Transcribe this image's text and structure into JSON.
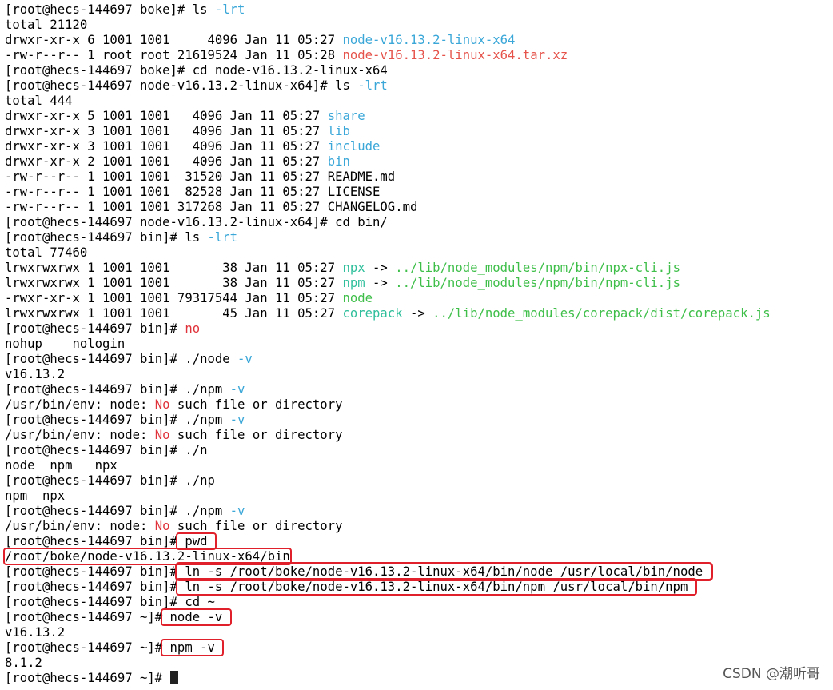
{
  "lines": [
    {
      "parts": [
        {
          "t": "[root@hecs-144697 boke]# ls "
        },
        {
          "t": "-lrt",
          "c": "flag"
        }
      ]
    },
    {
      "parts": [
        {
          "t": "total 21120"
        }
      ]
    },
    {
      "parts": [
        {
          "t": "drwxr-xr-x 6 1001 1001     4096 Jan 11 05:27 "
        },
        {
          "t": "node-v16.13.2-linux-x64",
          "c": "dir"
        }
      ]
    },
    {
      "parts": [
        {
          "t": "-rw-r--r-- 1 root root 21619524 Jan 11 05:28 "
        },
        {
          "t": "node-v16.13.2-linux-x64.tar.xz",
          "c": "arc"
        }
      ]
    },
    {
      "parts": [
        {
          "t": "[root@hecs-144697 boke]# cd node-v16.13.2-linux-x64"
        }
      ]
    },
    {
      "parts": [
        {
          "t": "[root@hecs-144697 node-v16.13.2-linux-x64]# ls "
        },
        {
          "t": "-lrt",
          "c": "flag"
        }
      ]
    },
    {
      "parts": [
        {
          "t": "total 444"
        }
      ]
    },
    {
      "parts": [
        {
          "t": "drwxr-xr-x 5 1001 1001   4096 Jan 11 05:27 "
        },
        {
          "t": "share",
          "c": "dir"
        }
      ]
    },
    {
      "parts": [
        {
          "t": "drwxr-xr-x 3 1001 1001   4096 Jan 11 05:27 "
        },
        {
          "t": "lib",
          "c": "dir"
        }
      ]
    },
    {
      "parts": [
        {
          "t": "drwxr-xr-x 3 1001 1001   4096 Jan 11 05:27 "
        },
        {
          "t": "include",
          "c": "dir"
        }
      ]
    },
    {
      "parts": [
        {
          "t": "drwxr-xr-x 2 1001 1001   4096 Jan 11 05:27 "
        },
        {
          "t": "bin",
          "c": "dir"
        }
      ]
    },
    {
      "parts": [
        {
          "t": "-rw-r--r-- 1 1001 1001  31520 Jan 11 05:27 README.md"
        }
      ]
    },
    {
      "parts": [
        {
          "t": "-rw-r--r-- 1 1001 1001  82528 Jan 11 05:27 LICENSE"
        }
      ]
    },
    {
      "parts": [
        {
          "t": "-rw-r--r-- 1 1001 1001 317268 Jan 11 05:27 CHANGELOG.md"
        }
      ]
    },
    {
      "parts": [
        {
          "t": "[root@hecs-144697 node-v16.13.2-linux-x64]# cd bin/"
        }
      ]
    },
    {
      "parts": [
        {
          "t": "[root@hecs-144697 bin]# ls "
        },
        {
          "t": "-lrt",
          "c": "flag"
        }
      ]
    },
    {
      "parts": [
        {
          "t": "total 77460"
        }
      ]
    },
    {
      "parts": [
        {
          "t": "lrwxrwxrwx 1 1001 1001       38 Jan 11 05:27 "
        },
        {
          "t": "npx",
          "c": "lnk"
        },
        {
          "t": " -> "
        },
        {
          "t": "../lib/node_modules/npm/bin/npx-cli.js",
          "c": "exe"
        }
      ]
    },
    {
      "parts": [
        {
          "t": "lrwxrwxrwx 1 1001 1001       38 Jan 11 05:27 "
        },
        {
          "t": "npm",
          "c": "lnk"
        },
        {
          "t": " -> "
        },
        {
          "t": "../lib/node_modules/npm/bin/npm-cli.js",
          "c": "exe"
        }
      ]
    },
    {
      "parts": [
        {
          "t": "-rwxr-xr-x 1 1001 1001 79317544 Jan 11 05:27 "
        },
        {
          "t": "node",
          "c": "exe"
        }
      ]
    },
    {
      "parts": [
        {
          "t": "lrwxrwxrwx 1 1001 1001       45 Jan 11 05:27 "
        },
        {
          "t": "corepack",
          "c": "lnk"
        },
        {
          "t": " -> "
        },
        {
          "t": "../lib/node_modules/corepack/dist/corepack.js",
          "c": "exe"
        }
      ]
    },
    {
      "parts": [
        {
          "t": "[root@hecs-144697 bin]# "
        },
        {
          "t": "no",
          "c": "red"
        }
      ]
    },
    {
      "parts": [
        {
          "t": "nohup    nologin"
        }
      ]
    },
    {
      "parts": [
        {
          "t": "[root@hecs-144697 bin]# ./node "
        },
        {
          "t": "-v",
          "c": "flag"
        }
      ]
    },
    {
      "parts": [
        {
          "t": "v16.13.2"
        }
      ]
    },
    {
      "parts": [
        {
          "t": "[root@hecs-144697 bin]# ./npm "
        },
        {
          "t": "-v",
          "c": "flag"
        }
      ]
    },
    {
      "parts": [
        {
          "t": "/usr/bin/env: node: "
        },
        {
          "t": "No",
          "c": "red"
        },
        {
          "t": " such file or directory"
        }
      ]
    },
    {
      "parts": [
        {
          "t": "[root@hecs-144697 bin]# ./npm "
        },
        {
          "t": "-v",
          "c": "flag"
        }
      ]
    },
    {
      "parts": [
        {
          "t": "/usr/bin/env: node: "
        },
        {
          "t": "No",
          "c": "red"
        },
        {
          "t": " such file or directory"
        }
      ]
    },
    {
      "parts": [
        {
          "t": "[root@hecs-144697 bin]# ./n"
        }
      ]
    },
    {
      "parts": [
        {
          "t": "node  npm   npx"
        }
      ]
    },
    {
      "parts": [
        {
          "t": "[root@hecs-144697 bin]# ./np"
        }
      ]
    },
    {
      "parts": [
        {
          "t": "npm  npx"
        }
      ]
    },
    {
      "parts": [
        {
          "t": "[root@hecs-144697 bin]# ./npm "
        },
        {
          "t": "-v",
          "c": "flag"
        }
      ]
    },
    {
      "parts": [
        {
          "t": "/usr/bin/env: node: "
        },
        {
          "t": "No",
          "c": "red"
        },
        {
          "t": " such file or directory"
        }
      ]
    },
    {
      "parts": [
        {
          "t": "[root@hecs-144697 bin]#"
        },
        {
          "t": " pwd ",
          "h": "hl"
        }
      ]
    },
    {
      "parts": [
        {
          "t": "/root/boke/node-v16.13.2-linux-x64/bin",
          "h": "hl"
        }
      ]
    },
    {
      "parts": [
        {
          "t": "[root@hecs-144697 bin]#"
        },
        {
          "t": " ln -s /root/boke/node-v16.13.2-linux-x64/bin/node /usr/local/bin/node ",
          "h": "hl-thick"
        }
      ]
    },
    {
      "parts": [
        {
          "t": "[root@hecs-144697 bin]#"
        },
        {
          "t": " ln -s /root/boke/node-v16.13.2-linux-x64/bin/npm /usr/local/bin/npm ",
          "h": "hl"
        }
      ]
    },
    {
      "parts": [
        {
          "t": "[root@hecs-144697 bin]# cd ~"
        }
      ]
    },
    {
      "parts": [
        {
          "t": "[root@hecs-144697 ~]#"
        },
        {
          "t": " node -v ",
          "h": "hl"
        }
      ]
    },
    {
      "parts": [
        {
          "t": "v16.13.2"
        }
      ]
    },
    {
      "parts": [
        {
          "t": "[root@hecs-144697 ~]#"
        },
        {
          "t": " npm -v ",
          "h": "hl"
        }
      ]
    },
    {
      "parts": [
        {
          "t": "8.1.2"
        }
      ]
    },
    {
      "parts": [
        {
          "t": "[root@hecs-144697 ~]# "
        }
      ],
      "cursor": true
    }
  ],
  "watermark": "CSDN @潮听哥"
}
